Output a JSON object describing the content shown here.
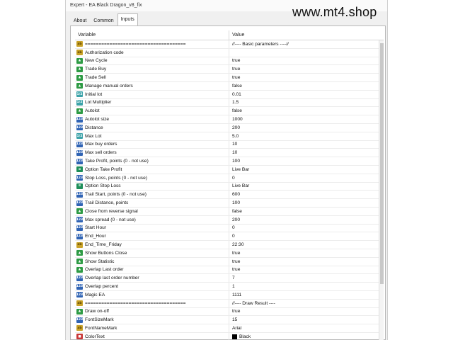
{
  "window": {
    "title": "Expert - EA Black Dragon_v8_fix"
  },
  "watermark": "www.mt4.shop",
  "tabs": [
    {
      "label": "About"
    },
    {
      "label": "Common"
    },
    {
      "label": "Inputs",
      "active": true
    }
  ],
  "table": {
    "headers": {
      "variable": "Variable",
      "value": "Value"
    },
    "rows": [
      {
        "type": "str",
        "name": "=====================================",
        "value": "//---- Basic parameters ----//"
      },
      {
        "type": "str",
        "name": "Authorization code",
        "value": ""
      },
      {
        "type": "bool",
        "name": "New Cycle",
        "value": "true"
      },
      {
        "type": "bool",
        "name": "Trade Buy",
        "value": "true"
      },
      {
        "type": "bool",
        "name": "Trade Sell",
        "value": "true"
      },
      {
        "type": "bool",
        "name": "Manage manual orders",
        "value": "false"
      },
      {
        "type": "dbl",
        "name": "Initial lot",
        "value": "0.01"
      },
      {
        "type": "dbl",
        "name": "Lot Multiplier",
        "value": "1.5"
      },
      {
        "type": "bool",
        "name": "Autolot",
        "value": "false"
      },
      {
        "type": "num",
        "name": "Autolot size",
        "value": "1000"
      },
      {
        "type": "num",
        "name": "Distance",
        "value": "200"
      },
      {
        "type": "dbl",
        "name": "Max Lot",
        "value": "5.0"
      },
      {
        "type": "num",
        "name": "Max buy orders",
        "value": "10"
      },
      {
        "type": "num",
        "name": "Max sell orders",
        "value": "10"
      },
      {
        "type": "num",
        "name": "Take Profit, points (0 - not use)",
        "value": "100"
      },
      {
        "type": "enum",
        "name": "Option Take Profit",
        "value": "Live Bar"
      },
      {
        "type": "num",
        "name": "Stop Loss, points (0 - not use)",
        "value": "0"
      },
      {
        "type": "enum",
        "name": "Option Stop Loss",
        "value": "Live Bar"
      },
      {
        "type": "num",
        "name": "Trail Start, points (0 - not use)",
        "value": "600"
      },
      {
        "type": "num",
        "name": "Trail Distance, points",
        "value": "100"
      },
      {
        "type": "bool",
        "name": "Close from reverse signal",
        "value": "false"
      },
      {
        "type": "num",
        "name": "Max spread (0 - not use)",
        "value": "200"
      },
      {
        "type": "num",
        "name": "Start Hour",
        "value": "0"
      },
      {
        "type": "num",
        "name": "End_Hour",
        "value": "0"
      },
      {
        "type": "str",
        "name": "End_Time_Friday",
        "value": "22:30"
      },
      {
        "type": "bool",
        "name": "Show Buttons Close",
        "value": "true"
      },
      {
        "type": "bool",
        "name": "Show Statistic",
        "value": "true"
      },
      {
        "type": "bool",
        "name": "Overlap Last order",
        "value": "true"
      },
      {
        "type": "num",
        "name": "Overlap last order number",
        "value": "7"
      },
      {
        "type": "num",
        "name": "Overlap percent",
        "value": "1"
      },
      {
        "type": "num",
        "name": "Magic EA",
        "value": "1111"
      },
      {
        "type": "str",
        "name": "=====================================",
        "value": "//---- Draw Result ----"
      },
      {
        "type": "bool",
        "name": "Draw on-off",
        "value": "true"
      },
      {
        "type": "num",
        "name": "FontSizeMark",
        "value": "15"
      },
      {
        "type": "str",
        "name": "FontNameMark",
        "value": "Arial"
      },
      {
        "type": "col",
        "name": "ColorText",
        "value": "Black",
        "swatch_color": "#000000"
      }
    ]
  }
}
